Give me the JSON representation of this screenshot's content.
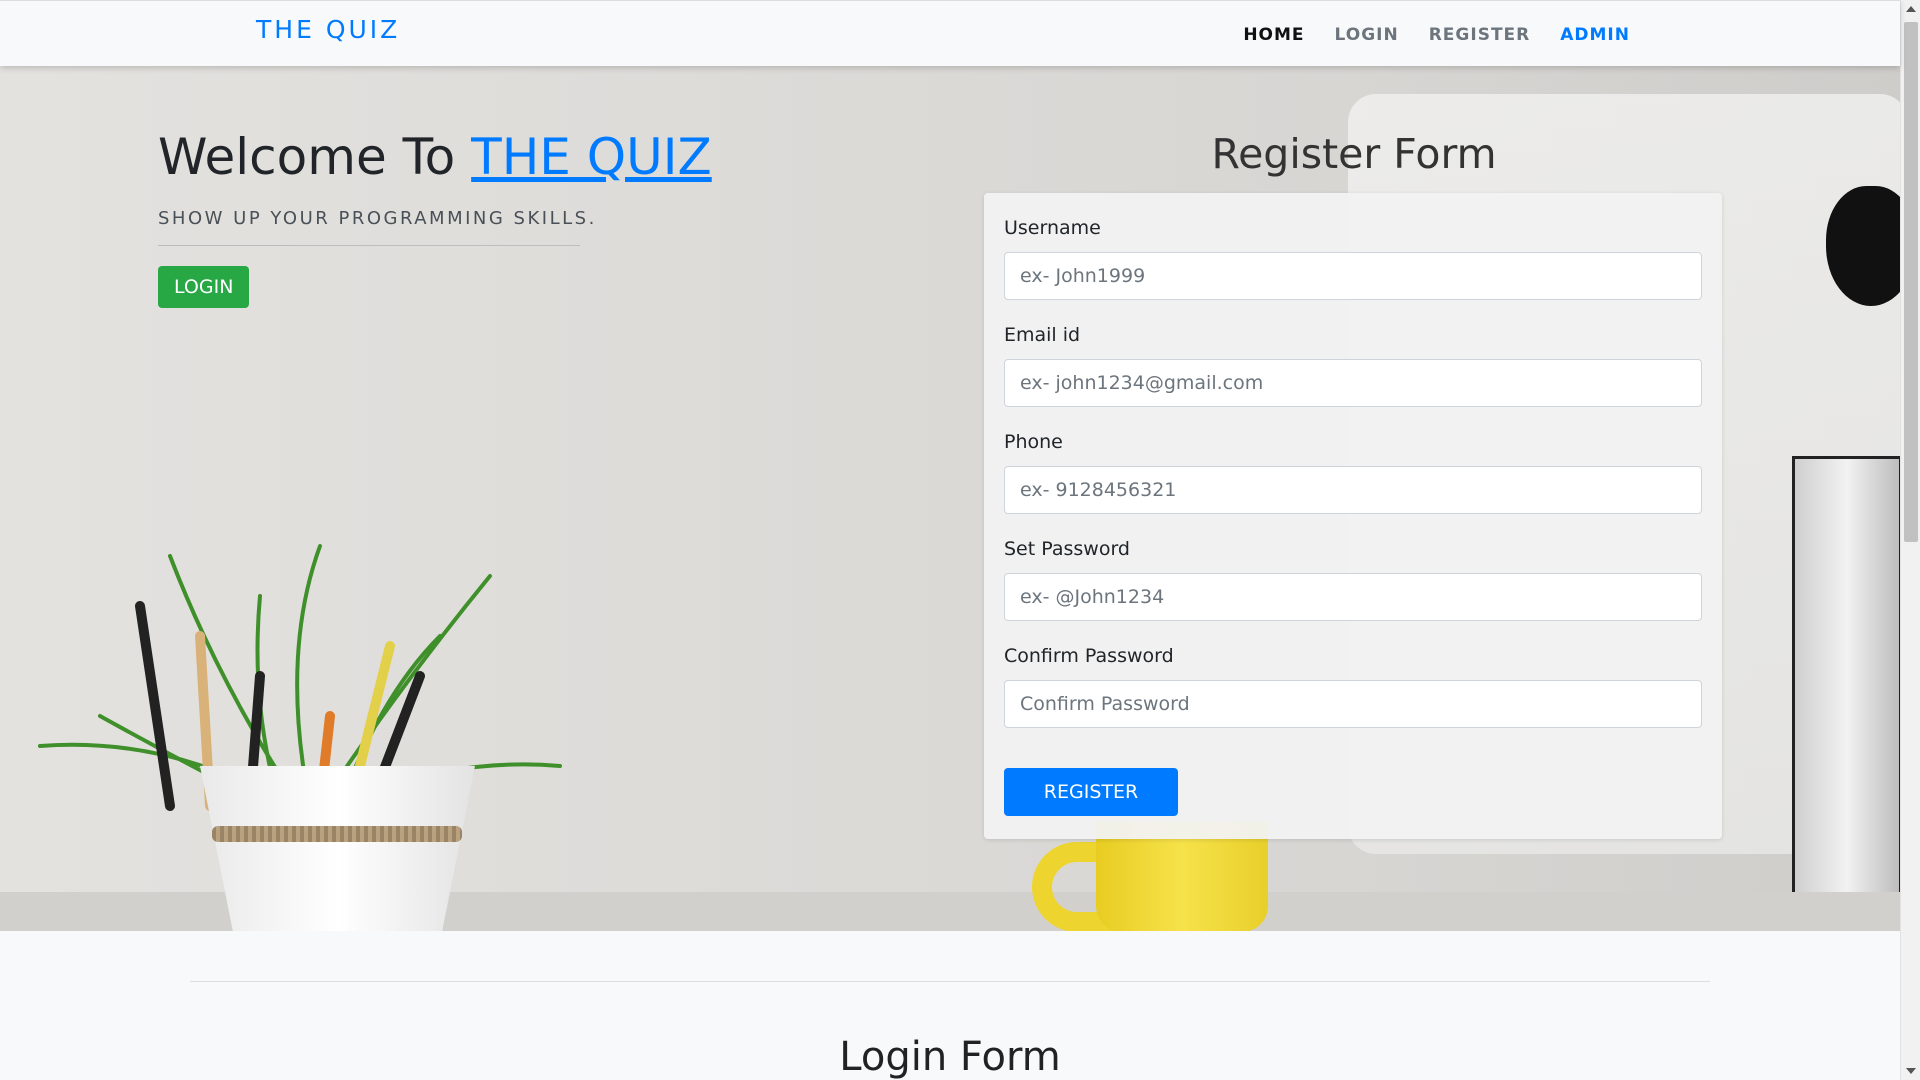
{
  "nav": {
    "brand": "THE QUIZ",
    "items": [
      {
        "label": "HOME"
      },
      {
        "label": "LOGIN"
      },
      {
        "label": "REGISTER"
      },
      {
        "label": "ADMIN"
      }
    ]
  },
  "hero": {
    "welcome_prefix": "Welcome To",
    "welcome_link": "THE QUIZ",
    "tagline": "SHOW UP YOUR PROGRAMMING SKILLS.",
    "login_button": "LOGIN"
  },
  "register": {
    "title": "Register Form",
    "fields": [
      {
        "label": "Username",
        "placeholder": "ex- John1999"
      },
      {
        "label": "Email id",
        "placeholder": "ex- john1234@gmail.com"
      },
      {
        "label": "Phone",
        "placeholder": "ex- 9128456321"
      },
      {
        "label": "Set Password",
        "placeholder": "ex- @John1234"
      },
      {
        "label": "Confirm Password",
        "placeholder": "Confirm Password"
      }
    ],
    "submit": "REGISTER"
  },
  "login_section": {
    "title": "Login Form"
  },
  "colors": {
    "primary": "#007bff",
    "success": "#28a745",
    "navbar_bg": "#f8f9fa"
  }
}
